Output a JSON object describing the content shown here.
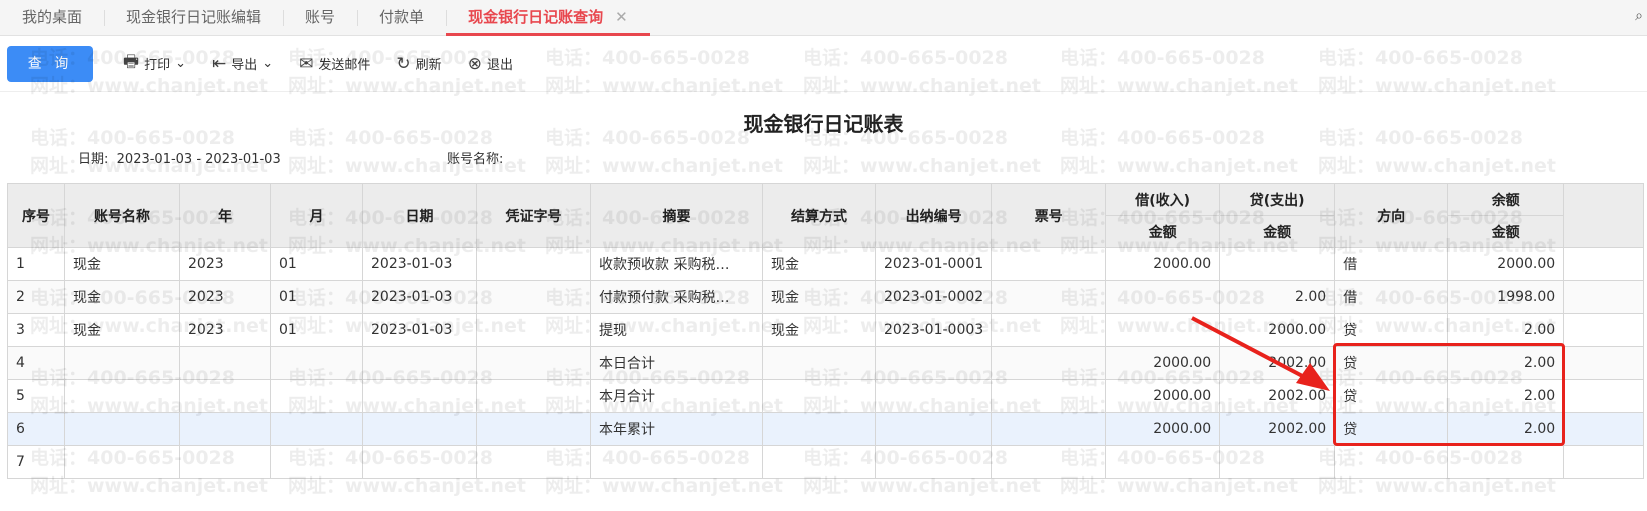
{
  "tabs": [
    "我的桌面",
    "现金银行日记账编辑",
    "账号",
    "付款单",
    "现金银行日记账查询"
  ],
  "toolbar": {
    "query": "查 询",
    "print": "打印",
    "export": "导出",
    "email": "发送邮件",
    "refresh": "刷新",
    "exit": "退出"
  },
  "report": {
    "title": "现金银行日记账表",
    "date_label": "日期:",
    "date_value": "2023-01-03 - 2023-01-03",
    "account_label": "账号名称:",
    "account_value": ""
  },
  "headers": {
    "seq": "序号",
    "account": "账号名称",
    "year": "年",
    "month": "月",
    "date": "日期",
    "voucher": "凭证字号",
    "summary": "摘要",
    "settle": "结算方式",
    "cashier": "出纳编号",
    "ticket": "票号",
    "debit": "借(收入)",
    "credit": "贷(支出)",
    "direction": "方向",
    "balance": "余额",
    "amount": "金额"
  },
  "rows": [
    [
      "1",
      "现金",
      "2023",
      "01",
      "2023-01-03",
      "",
      "收款预收款 采购税…",
      "现金",
      "2023-01-0001",
      "",
      "2000.00",
      "",
      "借",
      "2000.00"
    ],
    [
      "2",
      "现金",
      "2023",
      "01",
      "2023-01-03",
      "",
      "付款预付款 采购税…",
      "现金",
      "2023-01-0002",
      "",
      "",
      "2.00",
      "借",
      "1998.00"
    ],
    [
      "3",
      "现金",
      "2023",
      "01",
      "2023-01-03",
      "",
      "提现",
      "现金",
      "2023-01-0003",
      "",
      "",
      "2000.00",
      "贷",
      "2.00"
    ],
    [
      "4",
      "",
      "",
      "",
      "",
      "",
      "本日合计",
      "",
      "",
      "",
      "2000.00",
      "2002.00",
      "贷",
      "2.00"
    ],
    [
      "5",
      "",
      "",
      "",
      "",
      "",
      "本月合计",
      "",
      "",
      "",
      "2000.00",
      "2002.00",
      "贷",
      "2.00"
    ],
    [
      "6",
      "",
      "",
      "",
      "",
      "",
      "本年累计",
      "",
      "",
      "",
      "2000.00",
      "2002.00",
      "贷",
      "2.00"
    ],
    [
      "7",
      "",
      "",
      "",
      "",
      "",
      "",
      "",
      "",
      "",
      "",
      "",
      "",
      ""
    ]
  ],
  "watermark": {
    "phone": "电话：400-665-0028",
    "site": "网址：www.chanjet.net"
  },
  "colors": {
    "accent": "#e8474e",
    "primary": "#3c8cf6",
    "annotation": "#e8221c"
  }
}
